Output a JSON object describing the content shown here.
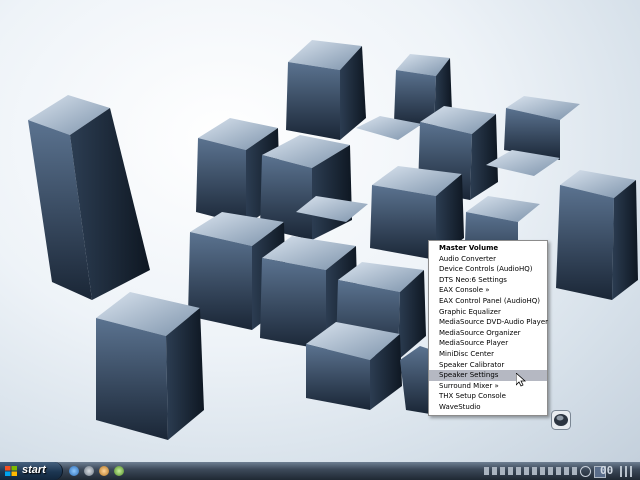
{
  "context_menu": {
    "items": [
      {
        "label": "Master Volume"
      },
      {
        "label": "Audio Converter"
      },
      {
        "label": "Device Controls (AudioHQ)"
      },
      {
        "label": "DTS Neo:6 Settings"
      },
      {
        "label": "EAX Console »"
      },
      {
        "label": "EAX Control Panel (AudioHQ)"
      },
      {
        "label": "Graphic Equalizer"
      },
      {
        "label": "MediaSource DVD-Audio Player"
      },
      {
        "label": "MediaSource Organizer"
      },
      {
        "label": "MediaSource Player"
      },
      {
        "label": "MiniDisc Center"
      },
      {
        "label": "Speaker Calibrator"
      },
      {
        "label": "Speaker Settings"
      },
      {
        "label": "Surround Mixer »"
      },
      {
        "label": "THX Setup Console"
      },
      {
        "label": "WaveStudio"
      }
    ],
    "highlighted_item": "Speaker Settings"
  },
  "taskbar": {
    "start_label": "start",
    "clock": "00"
  },
  "icons": {
    "tray_speaker": "speaker-icon",
    "start_logo": "windows-logo-icon"
  },
  "colors": {
    "menu_highlight": "#b5b8c2",
    "taskbar": "#2a3542",
    "cube": "#3a4f66"
  }
}
